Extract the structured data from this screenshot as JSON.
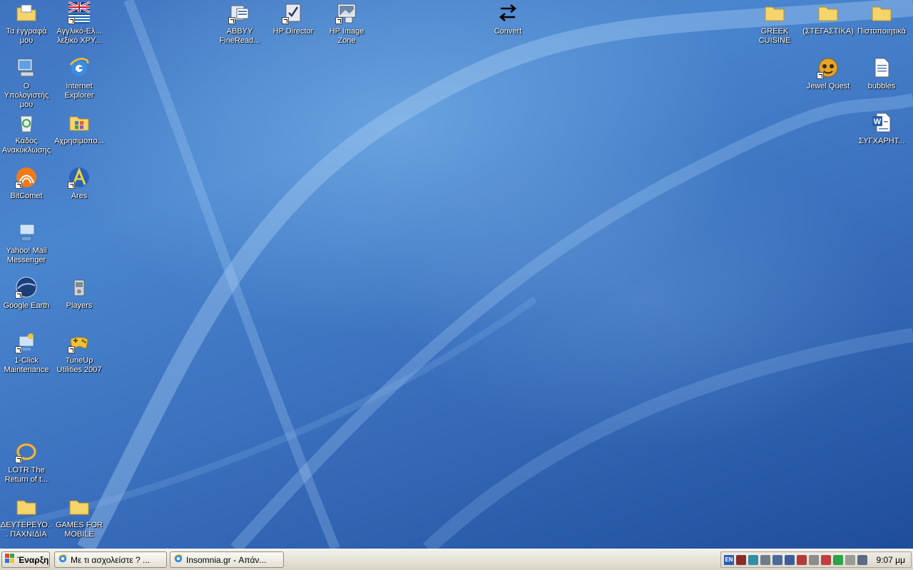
{
  "desktop": {
    "icons": {
      "my_documents": "Τα έγγραφά μου",
      "dictionary": "Αγγλικό-Ελ... λεξικό ΧΡΥ...",
      "my_computer": "Ο Υπολογιστής μου",
      "internet_explorer": "Internet Explorer",
      "recycle_bin": "Κάδος Ανακύκλωσης",
      "accessories": "Αχρησιμοπο...",
      "bitcomet": "BitComet",
      "ares": "Ares",
      "yahoo_messenger": "Yahoo! Mail Messenger",
      "google_earth": "Google Earth",
      "players": "Players",
      "one_click_maintenance": "1-Click Maintenance",
      "tuneup": "TuneUp Utilities 2007",
      "lotr": "LOTR The Return of t...",
      "secondary_games": "ΔΕΥΤΕΡΕΥΟ... ΠΑΧΝΙΔΙΑ",
      "games_mobile": "GAMES FOR MOBILE",
      "abbyy": "ABBYY FineRead...",
      "hp_director": "HP Director",
      "hp_image_zone": "HP Image Zone",
      "convert": "Convert",
      "greek_cuisine": "GREEK CUISINE",
      "stegastika": "(ΣΤΕΓΑΣΤΙΚΑ)",
      "pistopoiitika": "Πιστοποιητικά",
      "jewel_quest": "Jewel Quest",
      "bubbles": "bubbles",
      "sygxarit": "ΣΥΓΧΑΡΗΤ..."
    }
  },
  "taskbar": {
    "start_label": "Έναρξη",
    "tasks": [
      "Με τι ασχολείστε ? ...",
      "Insomnia.gr - Απάν..."
    ],
    "tray": {
      "language": "EN",
      "clock": "9:07 μμ"
    }
  }
}
